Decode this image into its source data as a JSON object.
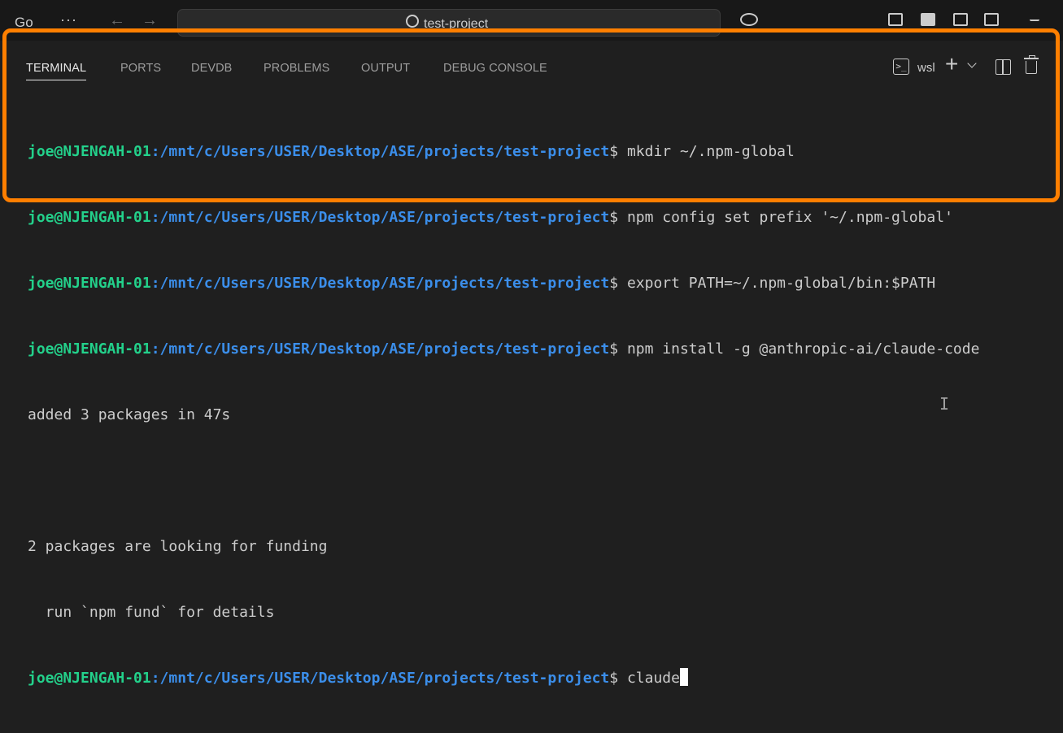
{
  "titlebar": {
    "menu_go": "Go",
    "menu_more": "···",
    "back_arrow": "←",
    "forward_arrow": "→",
    "search_text": "test-project"
  },
  "tabs": [
    {
      "label": "TERMINAL",
      "active": true
    },
    {
      "label": "PORTS",
      "active": false
    },
    {
      "label": "DEVDB",
      "active": false
    },
    {
      "label": "PROBLEMS",
      "active": false
    },
    {
      "label": "OUTPUT",
      "active": false
    },
    {
      "label": "DEBUG CONSOLE",
      "active": false
    }
  ],
  "toolbar": {
    "shell_label": "wsl",
    "launch_glyph": ">_",
    "plus_glyph": "+"
  },
  "terminal": {
    "user": "joe@NJENGAH-01",
    "path": ":/mnt/c/Users/USER/Desktop/ASE/projects/test-project",
    "prompt": "$ ",
    "commands": [
      "mkdir ~/.npm-global",
      "npm config set prefix '~/.npm-global'",
      "export PATH=~/.npm-global/bin:$PATH",
      "npm install -g @anthropic-ai/claude-code"
    ],
    "output": [
      "added 3 packages in 47s",
      "",
      "2 packages are looking for funding",
      "  run `npm fund` for details"
    ],
    "current_input": "claude"
  },
  "colors": {
    "highlight": "#ff7f00",
    "user": "#23d18b",
    "path": "#3b8eea",
    "background": "#1f1f1f"
  }
}
